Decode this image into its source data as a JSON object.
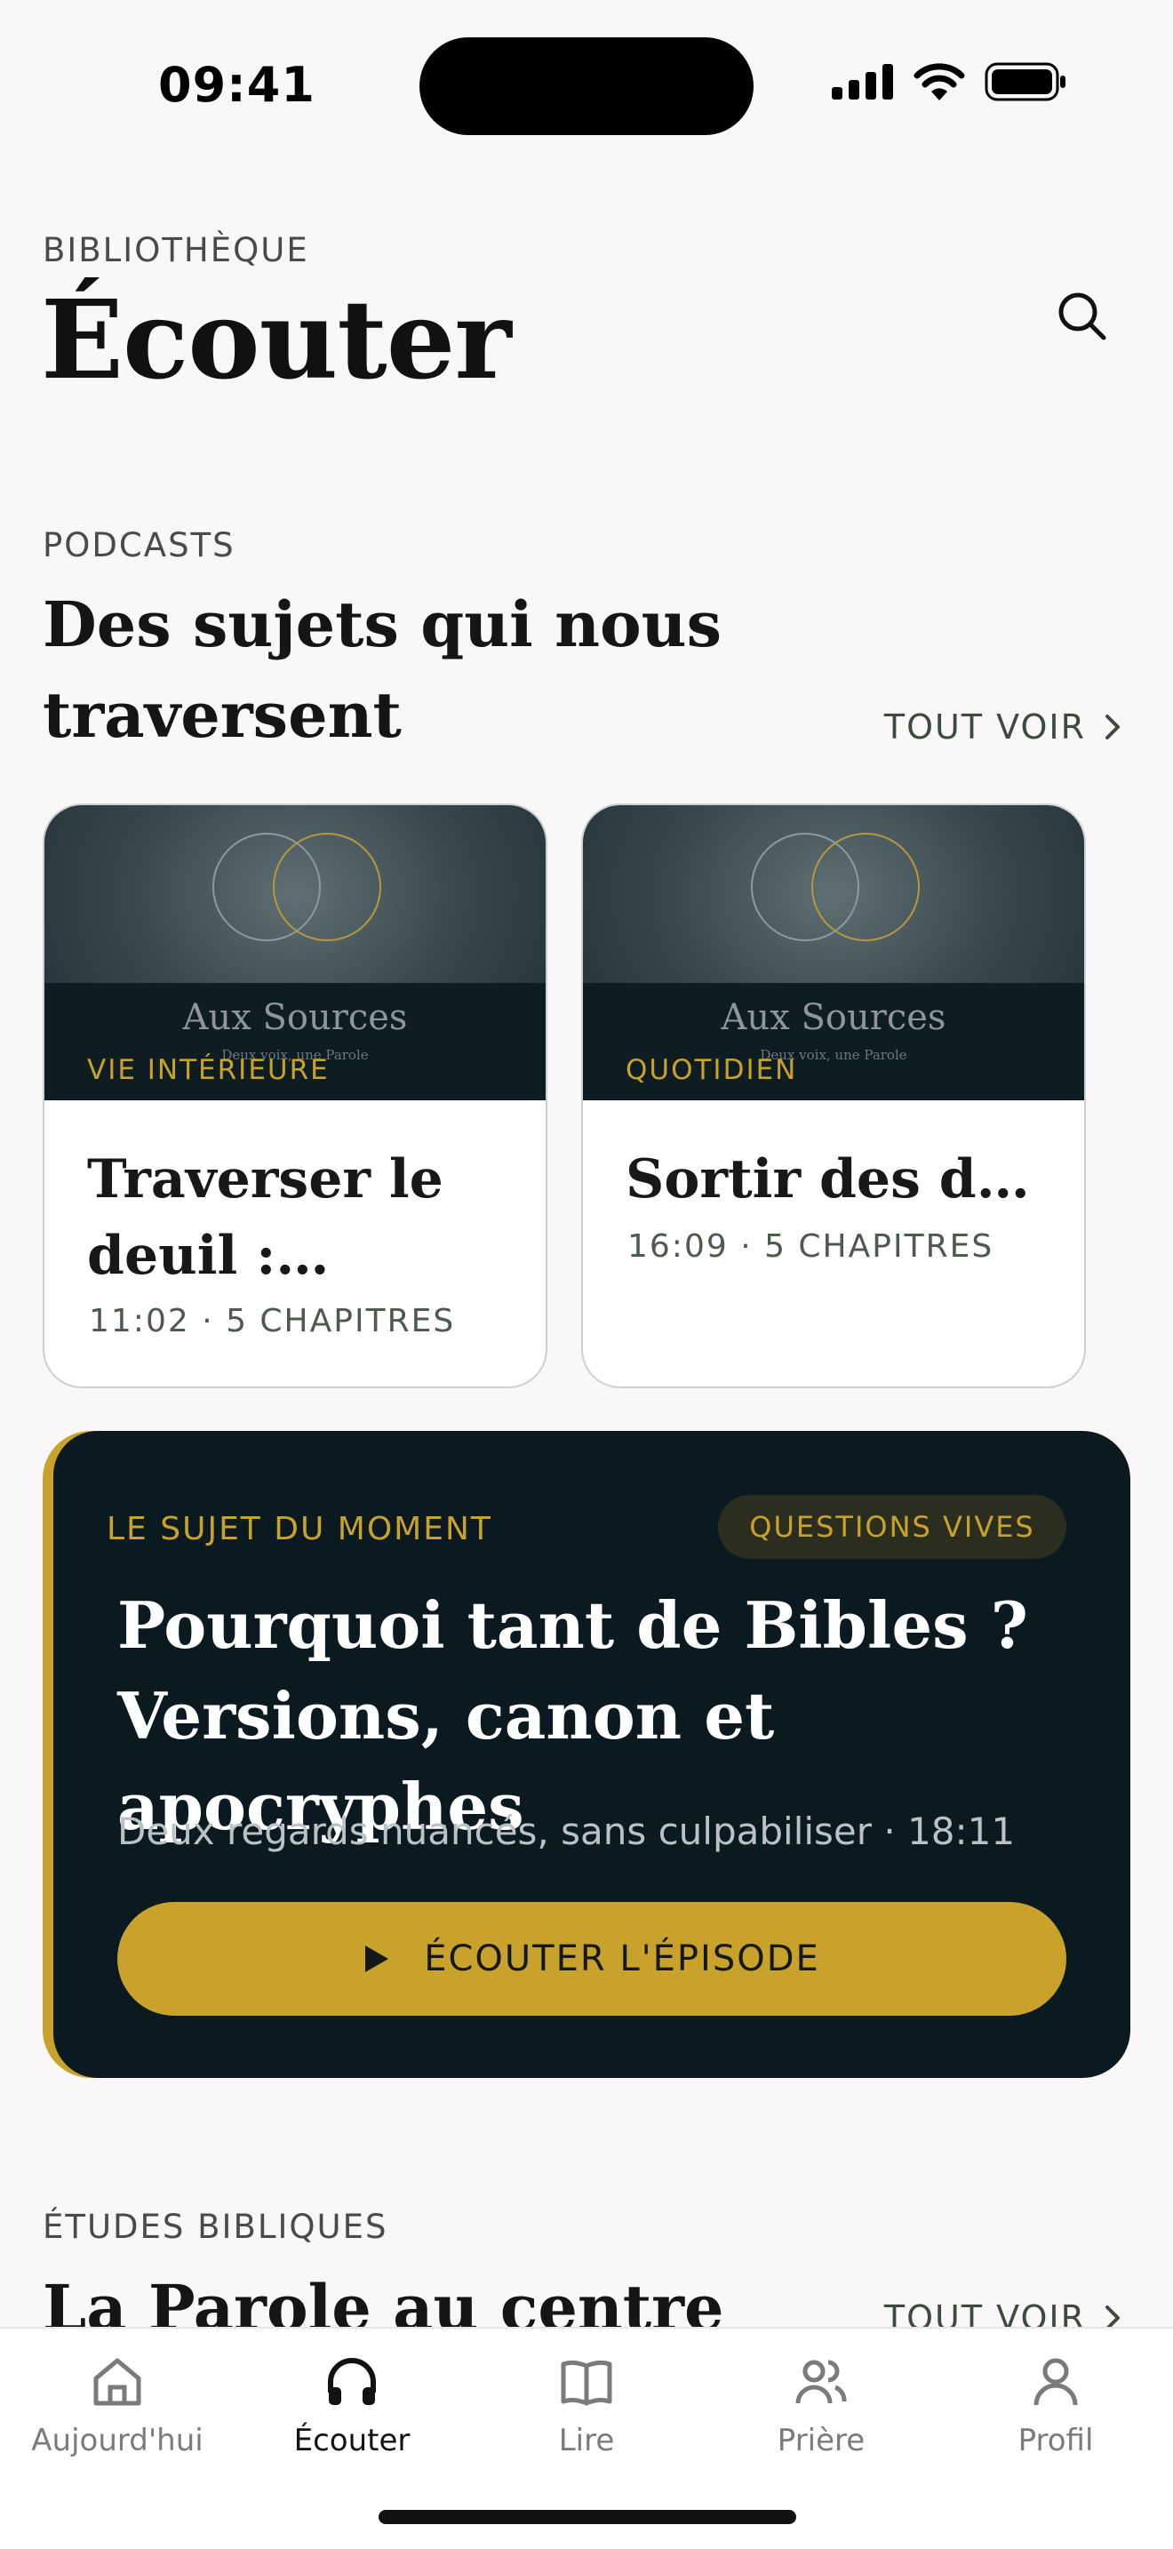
{
  "status": {
    "time": "09:41"
  },
  "header": {
    "eyebrow": "BIBLIOTHÈQUE",
    "title": "Écouter"
  },
  "podcasts": {
    "eyebrow": "PODCASTS",
    "title_line1": "Des sujets qui nous",
    "title_line2": "traversent",
    "see_all": "TOUT VOIR",
    "cards": [
      {
        "brand": "Aux Sources",
        "tagline": "Deux voix, une Parole",
        "tag": "VIE INTÉRIEURE",
        "title": "Traverser le deuil : pleurer sans perdre espoir",
        "meta": "11:02 · 5 CHAPITRES"
      },
      {
        "brand": "Aux Sources",
        "tagline": "Deux voix, une Parole",
        "tag": "QUOTIDIEN",
        "title": "Sortir des dettes",
        "meta": "16:09 · 5 CHAPITRES"
      }
    ]
  },
  "featured": {
    "eyebrow": "LE SUJET DU MOMENT",
    "pill": "QUESTIONS VIVES",
    "title": "Pourquoi tant de Bibles ? Versions, canon et apocryphes",
    "subtitle": "Deux regards nuancés, sans culpabiliser · 18:11",
    "cta": "ÉCOUTER L'ÉPISODE"
  },
  "studies": {
    "eyebrow": "ÉTUDES BIBLIQUES",
    "title": "La Parole au centre",
    "see_all": "TOUT VOIR"
  },
  "tabs": [
    {
      "label": "Aujourd'hui",
      "icon": "home-icon"
    },
    {
      "label": "Écouter",
      "icon": "headphones-icon"
    },
    {
      "label": "Lire",
      "icon": "book-icon"
    },
    {
      "label": "Prière",
      "icon": "people-icon"
    },
    {
      "label": "Profil",
      "icon": "person-icon"
    }
  ],
  "colors": {
    "accent": "#c9a22b",
    "dark": "#0b1a20",
    "background": "#f9f7f7"
  }
}
